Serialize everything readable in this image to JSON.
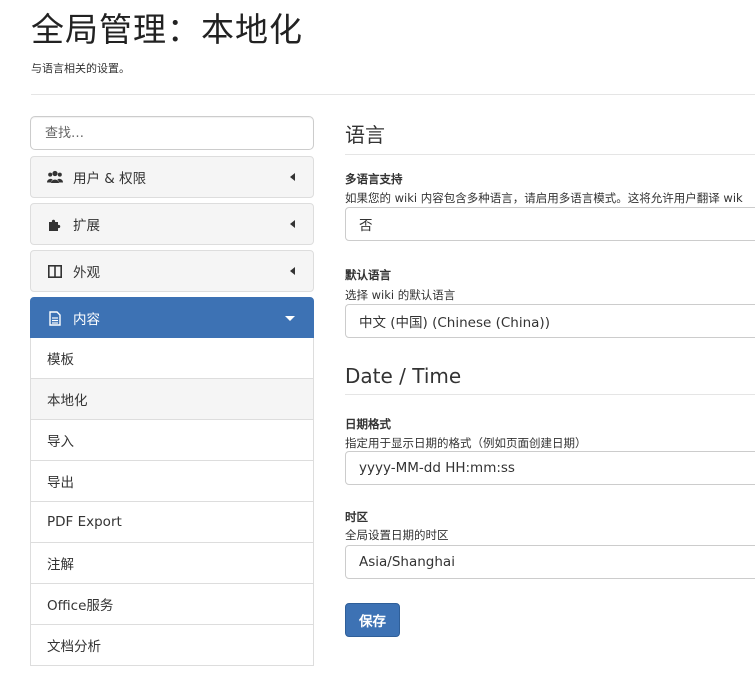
{
  "header": {
    "title": "全局管理：本地化",
    "subtitle": "与语言相关的设置。"
  },
  "sidebar": {
    "search_placeholder": "查找…",
    "panels": [
      {
        "label": "用户 & 权限",
        "icon": "users-icon",
        "expanded": false
      },
      {
        "label": "扩展",
        "icon": "puzzle-icon",
        "expanded": false
      },
      {
        "label": "外观",
        "icon": "columns-icon",
        "expanded": false
      },
      {
        "label": "内容",
        "icon": "file-text-icon",
        "expanded": true
      }
    ],
    "content_items": [
      {
        "label": "模板",
        "selected": false
      },
      {
        "label": "本地化",
        "selected": true
      },
      {
        "label": "导入",
        "selected": false
      },
      {
        "label": "导出",
        "selected": false
      },
      {
        "label": "PDF Export",
        "selected": false
      },
      {
        "label": "注解",
        "selected": false
      },
      {
        "label": "Office服务",
        "selected": false
      },
      {
        "label": "文档分析",
        "selected": false
      }
    ]
  },
  "main": {
    "language_section": {
      "title": "语言",
      "multilingual": {
        "label": "多语言支持",
        "hint": "如果您的 wiki 内容包含多种语言，请启用多语言模式。这将允许用户翻译 wik",
        "value": "否"
      },
      "default_language": {
        "label": "默认语言",
        "hint": "选择 wiki 的默认语言",
        "value": "中文 (中国) (Chinese (China))"
      }
    },
    "datetime_section": {
      "title": "Date / Time",
      "date_format": {
        "label": "日期格式",
        "hint": "指定用于显示日期的格式（例如页面创建日期）",
        "value": "yyyy-MM-dd HH:mm:ss"
      },
      "timezone": {
        "label": "时区",
        "hint": "全局设置日期的时区",
        "value": "Asia/Shanghai"
      }
    },
    "save_label": "保存"
  },
  "colors": {
    "accent": "#3d72b4",
    "panel_bg": "#f5f5f5",
    "border": "#dddddd"
  }
}
